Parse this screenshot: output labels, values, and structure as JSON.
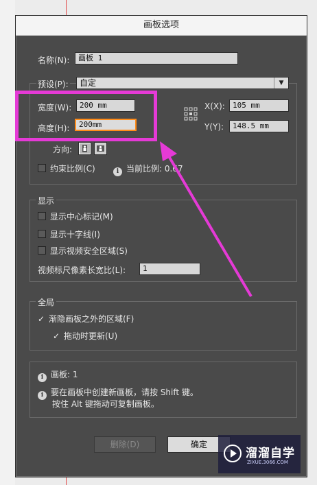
{
  "dialog": {
    "title": "画板选项"
  },
  "name": {
    "label": "名称(N):",
    "value": "画板 1"
  },
  "preset": {
    "label": "预设(P):",
    "value": "自定"
  },
  "size": {
    "width_label": "宽度(W):",
    "width_value": "200 mm",
    "height_label": "高度(H):",
    "height_value": "200mm",
    "x_label": "X(X):",
    "x_value": "105 mm",
    "y_label": "Y(Y):",
    "y_value": "148.5 mm",
    "orientation_label": "方向:"
  },
  "constrain": {
    "label": "约束比例(C)",
    "ratio_label": "当前比例:",
    "ratio_value": "0.67"
  },
  "display": {
    "legend": "显示",
    "center_mark": "显示中心标记(M)",
    "cross_hairs": "显示十字线(I)",
    "video_safe": "显示视频安全区域(S)",
    "pixel_ratio_label": "视频标尺像素长宽比(L):",
    "pixel_ratio_value": "1"
  },
  "global": {
    "legend": "全局",
    "fade": "渐隐画板之外的区域(F)",
    "update_drag": "拖动时更新(U)"
  },
  "info": {
    "artboards": "画板: 1",
    "tip_line1": "要在画板中创建新画板，请按 Shift 键。",
    "tip_line2": "按住 Alt 键拖动可复制画板。"
  },
  "buttons": {
    "delete": "删除(D)",
    "ok": "确定"
  },
  "watermark": {
    "brand": "溜溜自学",
    "url": "ZIXUE.3066.COM"
  },
  "colors": {
    "highlight": "#e53ad6",
    "active_border": "#ff8c1a",
    "panel": "#4a4a4a"
  }
}
